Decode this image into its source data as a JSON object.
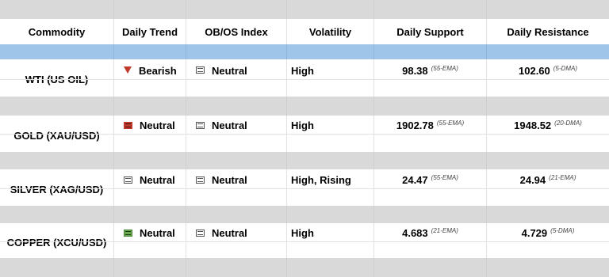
{
  "columns": [
    "Commodity",
    "Daily Trend",
    "OB/OS Index",
    "Volatility",
    "Daily Support",
    "Daily Resistance"
  ],
  "rows": [
    {
      "commodity": "WTI (US OIL)",
      "trend": {
        "label": "Bearish",
        "icon": "triangle-down-icon",
        "color": "#c0392b"
      },
      "obos": {
        "label": "Neutral",
        "icon": "neutral-icon"
      },
      "volatility": "High",
      "support": {
        "value": "98.38",
        "note": "(55-EMA)"
      },
      "resistance": {
        "value": "102.60",
        "note": "(5-DMA)"
      }
    },
    {
      "commodity": "GOLD (XAU/USD)",
      "trend": {
        "label": "Neutral",
        "icon": "neutral-red-icon",
        "color": "#c0392b"
      },
      "obos": {
        "label": "Neutral",
        "icon": "neutral-icon"
      },
      "volatility": "High",
      "support": {
        "value": "1902.78",
        "note": "(55-EMA)"
      },
      "resistance": {
        "value": "1948.52",
        "note": "(20-DMA)"
      }
    },
    {
      "commodity": "SILVER (XAG/USD)",
      "trend": {
        "label": "Neutral",
        "icon": "neutral-icon",
        "color": "#555555"
      },
      "obos": {
        "label": "Neutral",
        "icon": "neutral-icon"
      },
      "volatility": "High, Rising",
      "support": {
        "value": "24.47",
        "note": "(55-EMA)"
      },
      "resistance": {
        "value": "24.94",
        "note": "(21-EMA)"
      }
    },
    {
      "commodity": "COPPER (XCU/USD)",
      "trend": {
        "label": "Neutral",
        "icon": "neutral-green-icon",
        "color": "#6aa84f"
      },
      "obos": {
        "label": "Neutral",
        "icon": "neutral-icon"
      },
      "volatility": "High",
      "support": {
        "value": "4.683",
        "note": "(21-EMA)"
      },
      "resistance": {
        "value": "4.729",
        "note": "(5-DMA)"
      }
    }
  ],
  "colors": {
    "band_gray": "#d9d9d9",
    "band_blue": "#9fc5e8",
    "bearish": "#c0392b",
    "bullish_neutral": "#6aa84f"
  }
}
